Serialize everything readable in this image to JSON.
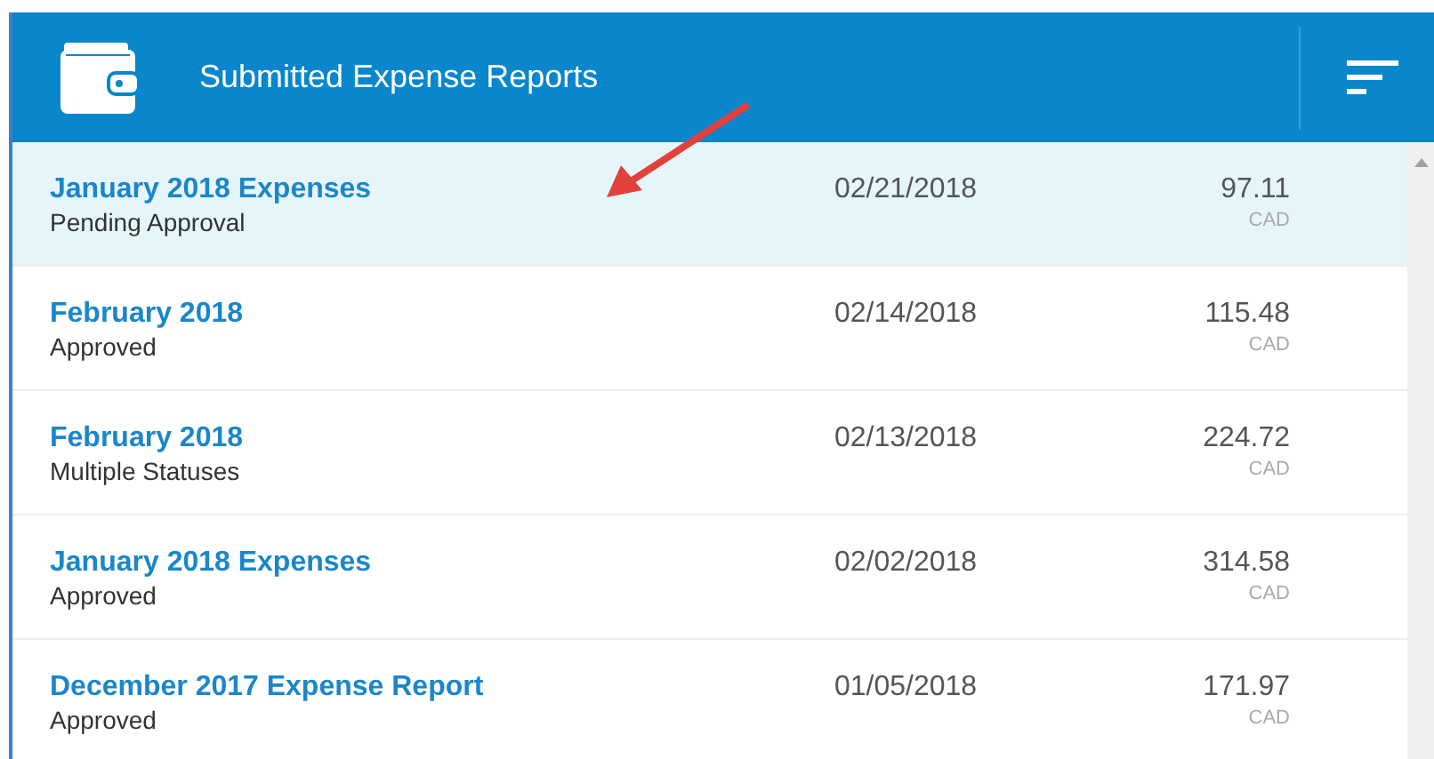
{
  "header": {
    "title": "Submitted Expense Reports"
  },
  "reports": [
    {
      "name": "January 2018 Expenses",
      "status": "Pending Approval",
      "date": "02/21/2018",
      "amount": "97.11",
      "currency": "CAD",
      "selected": true
    },
    {
      "name": "February 2018",
      "status": "Approved",
      "date": "02/14/2018",
      "amount": "115.48",
      "currency": "CAD",
      "selected": false
    },
    {
      "name": "February 2018",
      "status": "Multiple Statuses",
      "date": "02/13/2018",
      "amount": "224.72",
      "currency": "CAD",
      "selected": false
    },
    {
      "name": "January 2018 Expenses",
      "status": "Approved",
      "date": "02/02/2018",
      "amount": "314.58",
      "currency": "CAD",
      "selected": false
    },
    {
      "name": "December 2017 Expense Report",
      "status": "Approved",
      "date": "01/05/2018",
      "amount": "171.97",
      "currency": "CAD",
      "selected": false
    }
  ]
}
